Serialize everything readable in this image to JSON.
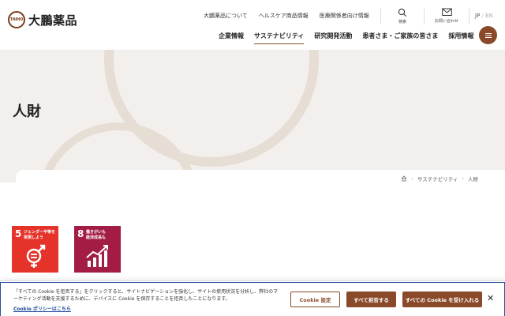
{
  "header": {
    "logo_mark": "TAIHO",
    "logo_text": "大鵬薬品",
    "util_nav": [
      "大鵬薬品について",
      "ヘルスケア商品情報",
      "医療関係者向け情報"
    ],
    "search_label": "検索",
    "contact_label": "お問い合わせ",
    "lang_jp": "JP",
    "lang_sep": "/",
    "lang_en": "EN",
    "main_nav": [
      "企業情報",
      "サステナビリティ",
      "研究開発活動",
      "患者さま・ご家族の皆さま",
      "採用情報"
    ],
    "active_index": 1
  },
  "hero": {
    "title": "人財"
  },
  "breadcrumb": {
    "items": [
      "サステナビリティ",
      "人財"
    ]
  },
  "sdgs": [
    {
      "number": "5",
      "text": "ジェンダー平等を\n実現しよう",
      "color": "#e5332a"
    },
    {
      "number": "8",
      "text": "働きがいも\n経済成長も",
      "color": "#a21c44"
    }
  ],
  "cookie": {
    "text": "「すべての Cookie を拒否する」をクリックすると、サイトナビゲーションを強化し、サイトの使用状況を分析し、弊社のマーケティング活動を支援するために、デバイスに Cookie を保存することを拒否したことになります。",
    "policy_link": "Cookie ポリシーはこちら",
    "settings_label": "Cookie 設定",
    "reject_label": "すべて拒否する",
    "accept_label": "すべての Cookie を受け入れる",
    "close_label": "✕"
  },
  "colors": {
    "brand": "#8a4a2a",
    "hero_bg": "#f2efec",
    "link": "#1f4a9a"
  }
}
